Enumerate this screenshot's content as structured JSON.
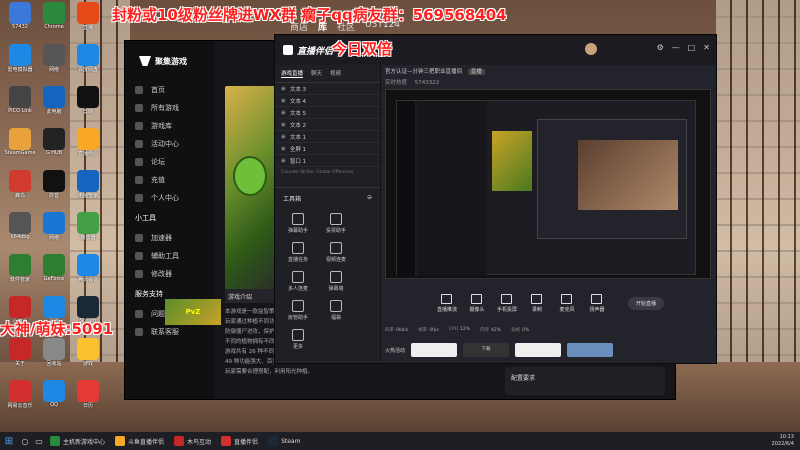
{
  "overlays": {
    "top_line": "封粉或10级粉丝牌进WX群 瘸子qq病友群：569568404",
    "double": "今日双倍",
    "left_line": "大神/萌妹:5091"
  },
  "top_nav": {
    "items": [
      "商店",
      "库",
      "社区",
      "U3T124"
    ]
  },
  "desktop_icons": [
    {
      "label": "57432",
      "color": "#3b78d8"
    },
    {
      "label": "雷电模拟器",
      "color": "#1e88e5"
    },
    {
      "label": "PICO Link",
      "color": "#444"
    },
    {
      "label": "SteamGame",
      "color": "#e8a13b"
    },
    {
      "label": "蜂鸟",
      "color": "#d13b2f"
    },
    {
      "label": "X64dbg",
      "color": "#555"
    },
    {
      "label": "软件管家",
      "color": "#2e7d32"
    },
    {
      "label": "小魔手",
      "color": "#c62828"
    },
    {
      "label": "关于",
      "color": "#c62828"
    },
    {
      "label": "网易云音乐",
      "color": "#d32f2f"
    },
    {
      "label": "Chrome",
      "color": "#2b8a3e"
    },
    {
      "label": "网络",
      "color": "#555"
    },
    {
      "label": "此电脑",
      "color": "#1565c0"
    },
    {
      "label": "G HUB",
      "color": "#222"
    },
    {
      "label": "抖音",
      "color": "#111"
    },
    {
      "label": "网络",
      "color": "#1976d2"
    },
    {
      "label": "GeForce",
      "color": "#2e7d32"
    },
    {
      "label": "迅雷",
      "color": "#1e88e5"
    },
    {
      "label": "回收站",
      "color": "#888"
    },
    {
      "label": "QQ",
      "color": "#1e88e5"
    },
    {
      "label": "直播",
      "color": "#e64a19"
    },
    {
      "label": "百度网盘",
      "color": "#1e88e5"
    },
    {
      "label": "剪映",
      "color": "#111"
    },
    {
      "label": "直播伴侣",
      "color": "#f9a825"
    },
    {
      "label": "电脑管家",
      "color": "#1565c0"
    },
    {
      "label": "播放器",
      "color": "#43a047"
    },
    {
      "label": "腾讯会议",
      "color": "#1e88e5"
    },
    {
      "label": "Steam",
      "color": "#1b2838"
    },
    {
      "label": "游戏",
      "color": "#fbc02d"
    },
    {
      "label": "日历",
      "color": "#e53935"
    }
  ],
  "launcher": {
    "brand": "聚集游戏",
    "nav": [
      "首页",
      "所有游戏",
      "游戏库",
      "活动中心",
      "论坛",
      "充值",
      "个人中心"
    ],
    "section2": "小工具",
    "tools": [
      "加速器",
      "辅助工具",
      "修改器"
    ],
    "section3": "服务支持",
    "links": [
      "问题反馈",
      "联系客服"
    ],
    "tab": "游戏介绍",
    "desc_lines": [
      "本游戏是一款益智策略类塔防游戏，",
      "玩家通过种植不同功能的植物",
      "防御僵尸进攻，保护房子。",
      "不同的植物拥有不同的技能，",
      "游戏共有 26 种不同的僵尸，",
      "49 种功能强大、百变的植物，",
      "玩家需要合理搭配，利用阳光种植。"
    ],
    "config": "配置要求",
    "thumb_title": "PvZ"
  },
  "obs": {
    "brand": "直播伴侣",
    "tabs": [
      "游戏直播",
      "聊天",
      "视频"
    ],
    "scenes": [
      "文本 3",
      "文本 4",
      "文本 5",
      "文本 2",
      "文本 1",
      "全屏 1",
      "窗口 1"
    ],
    "scene_hint": "Counter-Strike: Global Offensive",
    "tools_title": "工具箱",
    "tools": [
      "弹幕助手",
      "投票助手",
      "直播任务",
      "视频连麦",
      "多人连麦",
      "弹幕墙",
      "房管助手",
      "福袋",
      "更多"
    ],
    "stream_title": "官方认证—分钟三把职业直播间",
    "stream_badge": "直播",
    "stream_line2": "实时热度",
    "live_id": "5743322",
    "activity_title": "火热活动",
    "activity_label": "下载",
    "bottom_tools": [
      "直播推流",
      "摄像头",
      "手机投屏",
      "录制",
      "麦克风",
      "扬声器"
    ],
    "start": "开始直播",
    "status_bar": [
      "码率",
      "帧率",
      "CPU",
      "内存",
      "丢帧"
    ],
    "status_values": [
      "0kb/s",
      "0fps",
      "12%",
      "42%",
      "0%"
    ]
  },
  "taskbar": {
    "items": [
      {
        "label": "主机新游戏中心",
        "color": "#2b8a3e"
      },
      {
        "label": "斗鱼直播伴侣",
        "color": "#f9a825"
      },
      {
        "label": "木鸟互动",
        "color": "#c62828"
      },
      {
        "label": "直播伴侣",
        "color": "#d32f2f"
      },
      {
        "label": "Steam",
        "color": "#1b2838"
      }
    ],
    "time": "10:13",
    "date": "2022/6/4"
  }
}
